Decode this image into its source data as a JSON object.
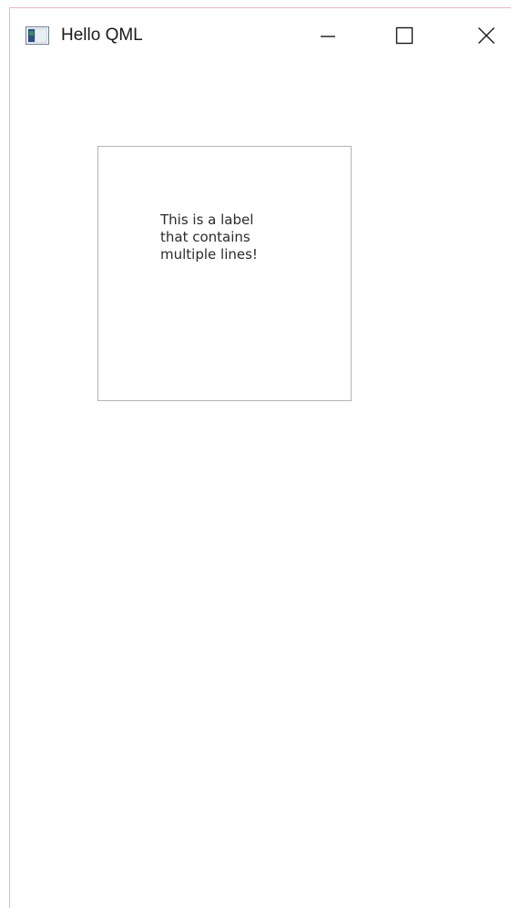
{
  "window": {
    "title": "Hello QML",
    "controls": {
      "minimize_icon": "minimize-icon",
      "maximize_icon": "maximize-icon",
      "close_icon": "close-icon"
    }
  },
  "content": {
    "label_text": "This is a label\nthat contains\nmultiple lines!"
  },
  "colors": {
    "window_background": "#ffffff",
    "frame_border": "#e6b8c4",
    "label_border": "#b4b4b4",
    "text": "#2b2b2b"
  }
}
